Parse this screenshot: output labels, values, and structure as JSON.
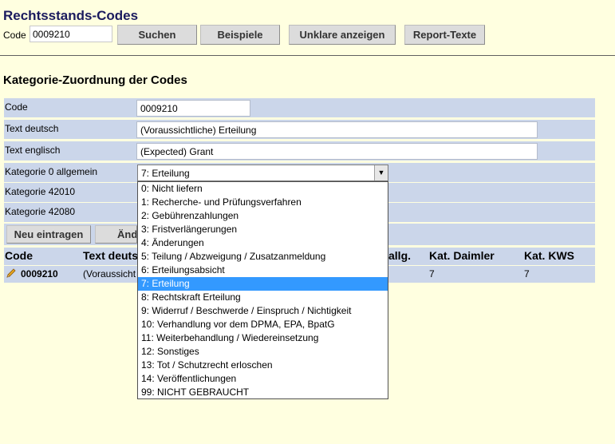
{
  "header": {
    "title": "Rechtsstands-Codes",
    "code_label": "Code",
    "code_value": "0009210",
    "buttons": [
      "Suchen",
      "Beispiele",
      "Unklare anzeigen",
      "Report-Texte"
    ]
  },
  "section_title": "Kategorie-Zuordnung der Codes",
  "form": {
    "code_label": "Code",
    "code_value": "0009210",
    "text_de_label": "Text deutsch",
    "text_de_value": "(Voraussichtliche) Erteilung",
    "text_en_label": "Text englisch",
    "text_en_value": "(Expected) Grant",
    "kat0_label": "Kategorie 0 allgemein",
    "kat0_value": "7: Erteilung",
    "kat42010_label": "Kategorie 42010",
    "kat42080_label": "Kategorie 42080",
    "btn_new": "Neu eintragen",
    "btn_change": "Änd"
  },
  "table": {
    "headers": [
      "Code",
      "Text deuts",
      "allg.",
      "Kat. Daimler",
      "Kat. KWS"
    ],
    "row": {
      "code": "0009210",
      "text": "(Voraussicht",
      "daimler": "7",
      "kws": "7"
    }
  },
  "dropdown": {
    "selected_index": 7,
    "options": [
      "0: Nicht liefern",
      "1: Recherche- und Prüfungsverfahren",
      "2: Gebührenzahlungen",
      "3: Fristverlängerungen",
      "4: Änderungen",
      "5: Teilung / Abzweigung / Zusatzanmeldung",
      "6: Erteilungsabsicht",
      "7: Erteilung",
      "8: Rechtskraft Erteilung",
      "9: Widerruf / Beschwerde / Einspruch / Nichtigkeit",
      "10: Verhandlung vor dem DPMA, EPA, BpatG",
      "11: Weiterbehandlung / Wiedereinsetzung",
      "12: Sonstiges",
      "13: Tot / Schutzrecht erloschen",
      "14: Veröffentlichungen",
      "99: NICHT GEBRAUCHT"
    ]
  },
  "icons": {
    "edit": "pencil-icon",
    "select_arrow": "chevron-down-icon"
  },
  "colors": {
    "background": "#ffffe0",
    "row": "#cbd6ea",
    "title": "#1a1a5e",
    "selection": "#3399ff"
  }
}
